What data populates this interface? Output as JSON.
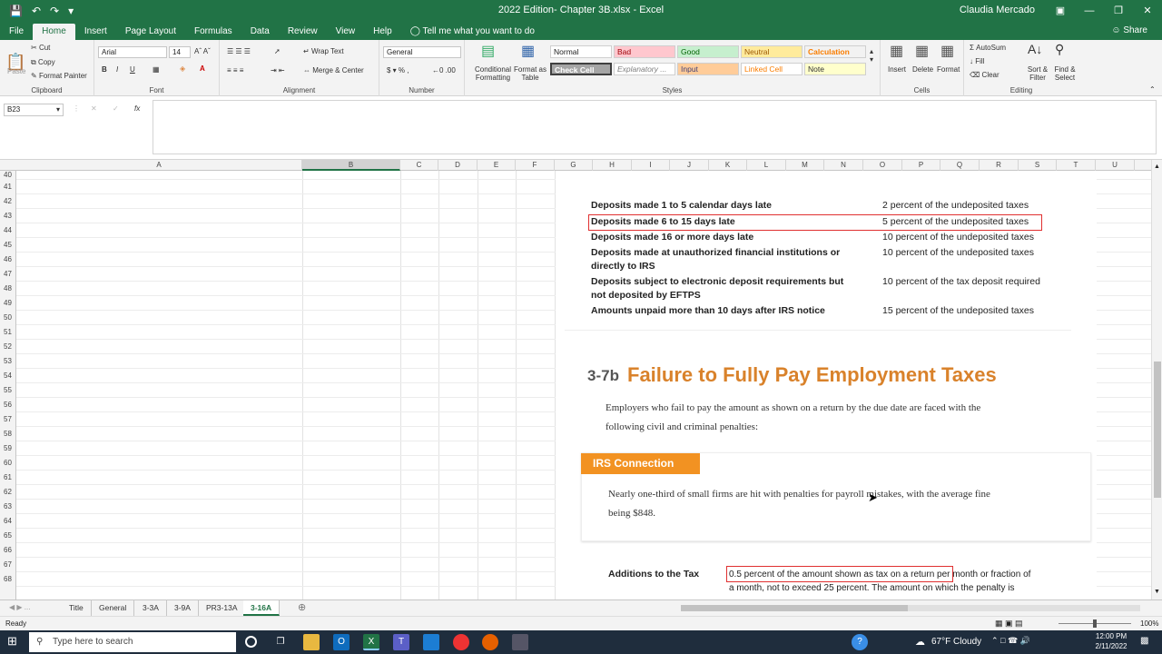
{
  "window": {
    "title": "2022 Edition- Chapter 3B.xlsx  -  Excel",
    "user": "Claudia Mercado",
    "share": "Share"
  },
  "ribbon_tabs": [
    "File",
    "Home",
    "Insert",
    "Page Layout",
    "Formulas",
    "Data",
    "Review",
    "View",
    "Help"
  ],
  "tell_me": "Tell me what you want to do",
  "clipboard": {
    "cut": "Cut",
    "copy": "Copy",
    "format_painter": "Format Painter",
    "paste": "Paste",
    "label": "Clipboard"
  },
  "font": {
    "name": "Arial",
    "size": "14",
    "label": "Font"
  },
  "alignment": {
    "wrap": "Wrap Text",
    "merge": "Merge & Center",
    "label": "Alignment"
  },
  "number": {
    "format": "General",
    "label": "Number"
  },
  "styles": {
    "conditional": "Conditional Formatting",
    "format_table": "Format as Table",
    "cells": [
      "Normal",
      "Bad",
      "Good",
      "Neutral",
      "Calculation",
      "Check Cell",
      "Explanatory ...",
      "Input",
      "Linked Cell",
      "Note"
    ],
    "label": "Styles"
  },
  "cells_group": {
    "insert": "Insert",
    "delete": "Delete",
    "format": "Format",
    "label": "Cells"
  },
  "editing": {
    "autosum": "AutoSum",
    "fill": "Fill",
    "clear": "Clear",
    "sort": "Sort & Filter",
    "find": "Find & Select",
    "label": "Editing"
  },
  "name_box": "B23",
  "columns": [
    "A",
    "B",
    "C",
    "D",
    "E",
    "F",
    "G",
    "H",
    "I",
    "J",
    "K",
    "L",
    "M",
    "N",
    "O",
    "P",
    "Q",
    "R",
    "S",
    "T",
    "U"
  ],
  "rows": [
    "40",
    "41",
    "42",
    "43",
    "44",
    "45",
    "46",
    "47",
    "48",
    "49",
    "50",
    "51",
    "52",
    "53",
    "54",
    "55",
    "56",
    "57",
    "58",
    "59",
    "60",
    "61",
    "62",
    "63",
    "64",
    "65",
    "66",
    "67",
    "68"
  ],
  "picture": {
    "penalties": [
      {
        "left": "Deposits made 1 to 5 calendar days late",
        "right": "2 percent of the undeposited taxes"
      },
      {
        "left": "Deposits made 6 to 15 days late",
        "right": "5 percent of the undeposited taxes"
      },
      {
        "left": "Deposits made 16 or more days late",
        "right": "10 percent of the undeposited taxes"
      },
      {
        "left": "Deposits made at unauthorized financial institutions or",
        "left2": "directly to IRS",
        "right": "10 percent of the undeposited taxes"
      },
      {
        "left": "Deposits subject to electronic deposit requirements but",
        "left2": "not deposited by EFTPS",
        "right": "10 percent of the tax deposit required"
      },
      {
        "left": "Amounts unpaid more than 10 days after IRS notice",
        "right": "15 percent of the undeposited taxes"
      }
    ],
    "section_num": "3-7b",
    "section_title": "Failure to Fully Pay Employment Taxes",
    "intro_1": "Employers who fail to pay the amount as shown on a return by the due date are faced with the",
    "intro_2": "following civil and criminal penalties:",
    "irs_label": "IRS Connection",
    "irs_1": "Nearly one-third of small firms are hit with penalties for payroll mistakes, with the average fine",
    "irs_2": "being $848.",
    "add_label": "Additions to the Tax",
    "add_1": "0.5 percent of the amount shown as tax on a return per month or fraction of",
    "add_2": "a month, not to exceed 25 percent. The amount on which the penalty is"
  },
  "sheets": [
    "Title",
    "General",
    "3-3A",
    "3-9A",
    "PR3-13A",
    "3-16A"
  ],
  "status": {
    "ready": "Ready",
    "zoom": "100%"
  },
  "taskbar": {
    "search": "Type here to search",
    "weather": "67°F  Cloudy",
    "time": "12:00 PM",
    "date": "2/11/2022"
  },
  "colors": {
    "excel_green": "#217346",
    "title_orange": "#d9822b",
    "irs_orange": "#f29222",
    "highlight_red": "#e03030"
  }
}
